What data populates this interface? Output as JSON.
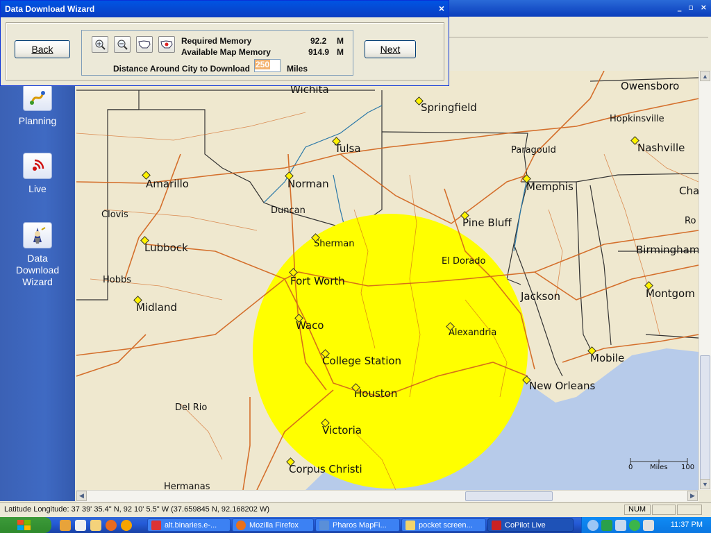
{
  "wizard": {
    "title": "Data Download Wizard",
    "close_glyph": "×",
    "back_label": "Back",
    "next_label": "Next",
    "required_memory_label": "Required Memory",
    "required_memory_value": "92.2",
    "required_memory_unit": "M",
    "available_memory_label": "Available Map Memory",
    "available_memory_value": "914.9",
    "available_memory_unit": "M",
    "distance_label": "Distance Around City to Download",
    "distance_value": "250",
    "distance_unit": "Miles",
    "tools": [
      "zoom-in-icon",
      "zoom-out-icon",
      "us-map-icon",
      "us-map-select-icon"
    ]
  },
  "app": {
    "window_controls": [
      "_",
      "▫",
      "×"
    ]
  },
  "sidebar": {
    "items": [
      {
        "label": "Planning",
        "icon": "planning-icon"
      },
      {
        "label": "Live",
        "icon": "live-signal-icon"
      },
      {
        "label": "Data Download Wizard",
        "icon": "wizard-icon"
      }
    ]
  },
  "map": {
    "highlight_color": "#ffff00",
    "water_color": "#b7cbea",
    "land_color": "#efe8cf",
    "scale_labels": [
      "0",
      "Miles",
      "100"
    ],
    "cities": [
      {
        "name": "Wichita"
      },
      {
        "name": "Springfield"
      },
      {
        "name": "Owensboro"
      },
      {
        "name": "Hopkinsville"
      },
      {
        "name": "Tulsa"
      },
      {
        "name": "Paragould"
      },
      {
        "name": "Nashville"
      },
      {
        "name": "Amarillo"
      },
      {
        "name": "Norman"
      },
      {
        "name": "Memphis"
      },
      {
        "name": "Cha"
      },
      {
        "name": "Clovis"
      },
      {
        "name": "Duncan"
      },
      {
        "name": "Pine Bluff"
      },
      {
        "name": "Ro"
      },
      {
        "name": "Sherman"
      },
      {
        "name": "Lubbock"
      },
      {
        "name": "Birmingham"
      },
      {
        "name": "El Dorado"
      },
      {
        "name": "Hobbs"
      },
      {
        "name": "Fort Worth"
      },
      {
        "name": "Jackson"
      },
      {
        "name": "Montgom"
      },
      {
        "name": "Midland"
      },
      {
        "name": "Waco"
      },
      {
        "name": "Alexandria"
      },
      {
        "name": "Mobile"
      },
      {
        "name": "College Station"
      },
      {
        "name": "New Orleans"
      },
      {
        "name": "Houston"
      },
      {
        "name": "Del Rio"
      },
      {
        "name": "Victoria"
      },
      {
        "name": "Corpus Christi"
      },
      {
        "name": "Hermanas"
      }
    ]
  },
  "status": {
    "latlon_label": "Latitude Longitude:",
    "latlon_value": "37 39' 35.4\" N,  92 10' 5.5\" W (37.659845 N, 92.168202 W)",
    "num": "NUM"
  },
  "taskbar": {
    "tasks": [
      {
        "label": "alt.binaries.e-...",
        "active": false
      },
      {
        "label": "Mozilla Firefox",
        "active": false
      },
      {
        "label": "Pharos MapFi...",
        "active": false
      },
      {
        "label": "pocket screen...",
        "active": false
      },
      {
        "label": "CoPilot Live",
        "active": true
      }
    ],
    "clock": "11:37 PM"
  }
}
